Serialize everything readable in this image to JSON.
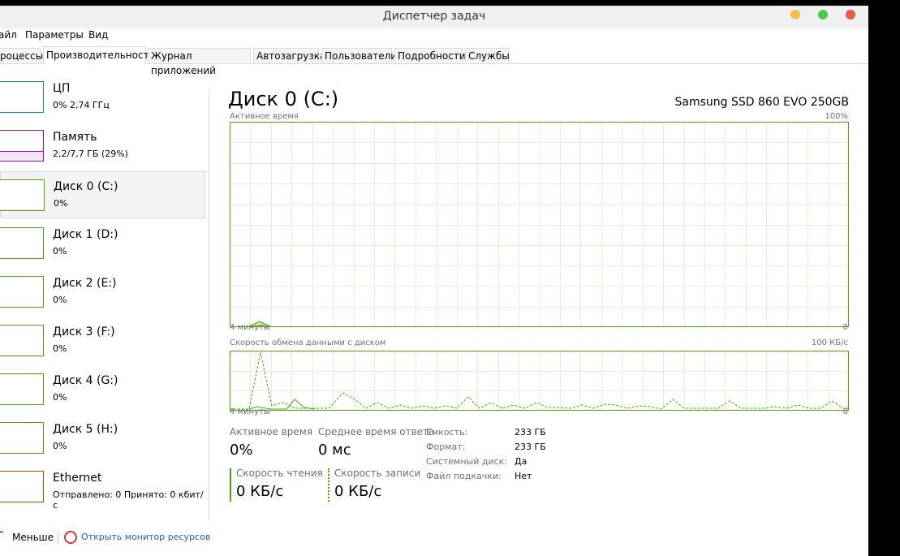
{
  "window": {
    "title": "Диспетчер задач"
  },
  "controls": {
    "minimize_color": "#f4be4f",
    "maximize_color": "#4cc94f",
    "close_color": "#ed594f"
  },
  "menu": {
    "file": "айл",
    "options": "Параметры",
    "view": "Вид"
  },
  "tabs": [
    {
      "label": "роцессы"
    },
    {
      "label": "Производительность"
    },
    {
      "label": "Журнал приложений"
    },
    {
      "label": "Автозагрузка"
    },
    {
      "label": "Пользователи"
    },
    {
      "label": "Подробности"
    },
    {
      "label": "Службы"
    }
  ],
  "sidebar": {
    "items": [
      {
        "name": "ЦП",
        "sub": "0% 2,74 ГГц",
        "color": "#1d7fb8"
      },
      {
        "name": "Память",
        "sub": "2,2/7,7 ГБ (29%)",
        "color": "#8b12ae",
        "usage": 0.29
      },
      {
        "name": "Диск 0 (C:)",
        "sub": "0%",
        "color": "#4da60c"
      },
      {
        "name": "Диск 1 (D:)",
        "sub": "0%",
        "color": "#4da60c"
      },
      {
        "name": "Диск 2 (E:)",
        "sub": "0%",
        "color": "#4da60c"
      },
      {
        "name": "Диск 3 (F:)",
        "sub": "0%",
        "color": "#4da60c"
      },
      {
        "name": "Диск 4 (G:)",
        "sub": "0%",
        "color": "#4da60c"
      },
      {
        "name": "Диск 5 (H:)",
        "sub": "0%",
        "color": "#4da60c"
      },
      {
        "name": "Ethernet",
        "sub": "Отправлено: 0 Принято: 0 кбит/с",
        "color": "#a74f01"
      }
    ]
  },
  "main": {
    "title": "Диск 0 (C:)",
    "model": "Samsung SSD 860 EVO 250GB",
    "graph1": {
      "label": "Активное время",
      "max": "100%",
      "time_left": "4 минуты",
      "time_right": "0"
    },
    "graph2": {
      "label": "Скорость обмена данными с диском",
      "max": "100 КБ/с",
      "time_left": "4 минуты",
      "time_right": "0"
    },
    "stats": {
      "active_label": "Активное время",
      "active_value": "0%",
      "resp_label": "Среднее время ответа",
      "resp_value": "0 мс",
      "read_label": "Скорость чтения",
      "read_value": "0 КБ/с",
      "write_label": "Скорость записи",
      "write_value": "0 КБ/с"
    },
    "props": [
      {
        "key": "Емкость:",
        "value": "233 ГБ"
      },
      {
        "key": "Формат:",
        "value": "233 ГБ"
      },
      {
        "key": "Системный диск:",
        "value": "Да"
      },
      {
        "key": "Файл подкачки:",
        "value": "Нет"
      }
    ]
  },
  "accent": {
    "disk": "#4da60c"
  },
  "footer": {
    "fewer": "Меньше",
    "resmon": "Открыть монитор ресурсов"
  }
}
